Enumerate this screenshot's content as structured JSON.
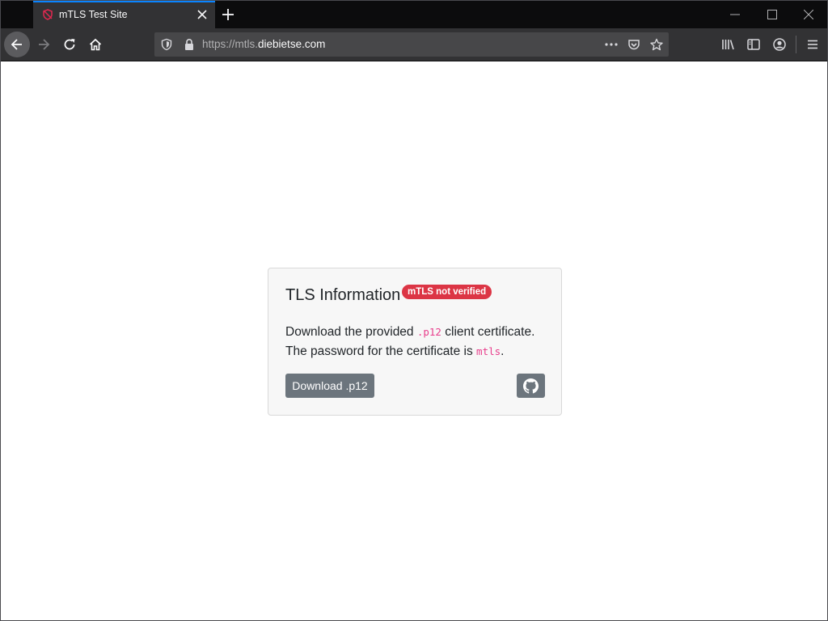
{
  "browser": {
    "tab": {
      "title": "mTLS Test Site",
      "favicon": "shield-broken-icon"
    },
    "window_controls": [
      "minimize-icon",
      "maximize-icon",
      "close-icon"
    ],
    "url": {
      "prefix": "https://mtls.",
      "domain": "diebietse.com"
    },
    "accent_color": "#0a84ff"
  },
  "card": {
    "title": "TLS Information",
    "badge": "mTLS not verified",
    "badge_color": "#dc3545",
    "line1_before": "Download the provided ",
    "line1_code": ".p12",
    "line1_after": " client certificate.",
    "line2_before": "The password for the certificate is ",
    "line2_code": "mtls",
    "line2_after": ".",
    "download_label": "Download .p12",
    "github_icon": "github-icon"
  }
}
